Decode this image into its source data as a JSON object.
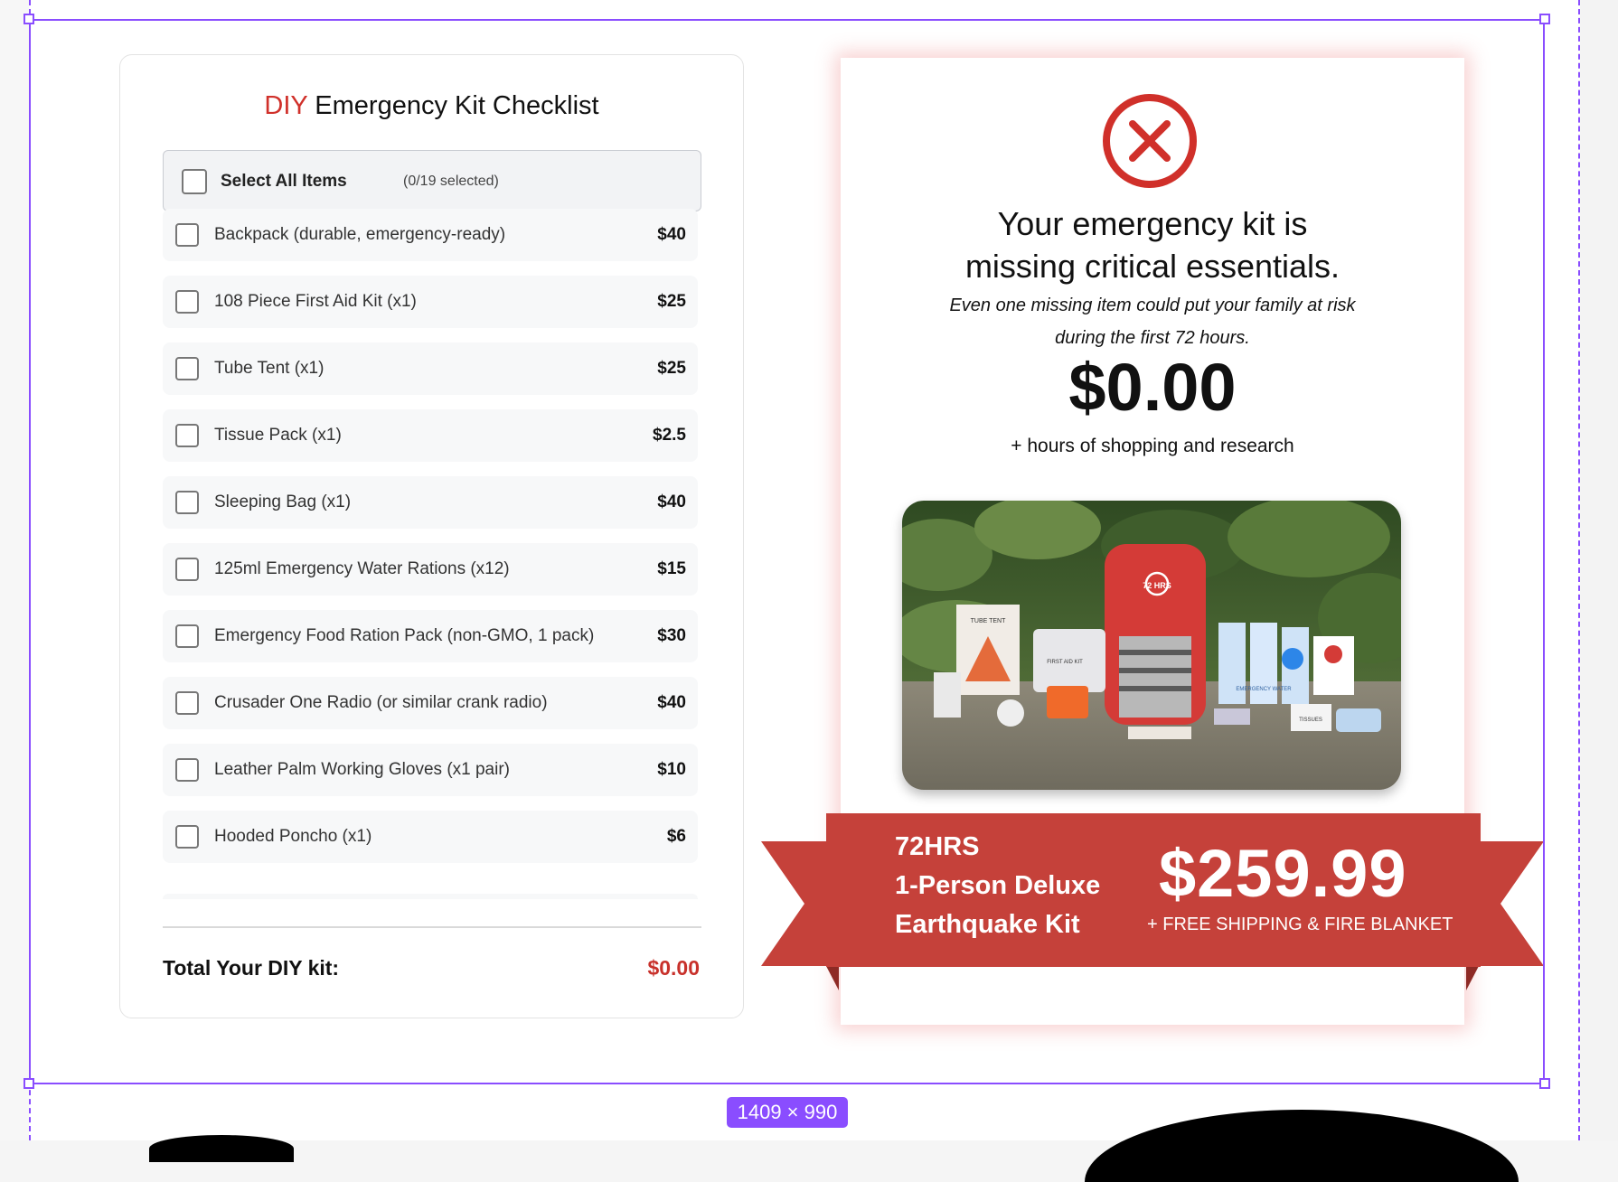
{
  "canvas": {
    "size_badge": "1409 × 990"
  },
  "checklist": {
    "title_highlight": "DIY",
    "title_rest": " Emergency Kit Checklist",
    "select_all_label": "Select All Items",
    "select_count": "(0/19 selected)",
    "items": [
      {
        "name": "Backpack (durable, emergency-ready)",
        "price": "$40"
      },
      {
        "name": "108 Piece First Aid Kit (x1)",
        "price": "$25"
      },
      {
        "name": "Tube Tent (x1)",
        "price": "$25"
      },
      {
        "name": "Tissue Pack (x1)",
        "price": "$2.5"
      },
      {
        "name": "Sleeping Bag (x1)",
        "price": "$40"
      },
      {
        "name": "125ml Emergency Water Rations (x12)",
        "price": "$15"
      },
      {
        "name": "Emergency Food Ration Pack (non-GMO, 1 pack)",
        "price": "$30"
      },
      {
        "name": "Crusader One Radio (or similar crank radio)",
        "price": "$40"
      },
      {
        "name": "Leather Palm Working Gloves (x1 pair)",
        "price": "$10"
      },
      {
        "name": "Hooded Poncho (x1)",
        "price": "$6"
      }
    ],
    "total_label": "Total Your DIY kit:",
    "total_value": "$0.00"
  },
  "result": {
    "headline_line1": "Your emergency kit is",
    "headline_line2": "missing critical essentials.",
    "subtext_line1": "Even one missing item could put your family at risk",
    "subtext_line2": "during the first 72 hours.",
    "price": "$0.00",
    "note": "+ hours of shopping and research",
    "photo_label": "72 HRS",
    "photo_tent_label": "TUBE TENT",
    "photo_aid_label": "FIRST AID KIT",
    "photo_water_label": "EMERGENCY WATER",
    "photo_tissue_label": "TISSUES"
  },
  "offer": {
    "brand": "72HRS",
    "product_line2": "1-Person Deluxe",
    "product_line3": "Earthquake Kit",
    "price": "$259.99",
    "extra": "+ FREE SHIPPING & FIRE BLANKET"
  },
  "colors": {
    "accent_red": "#c5413a",
    "danger_red": "#d0302a",
    "selection_purple": "#8a4dff"
  }
}
